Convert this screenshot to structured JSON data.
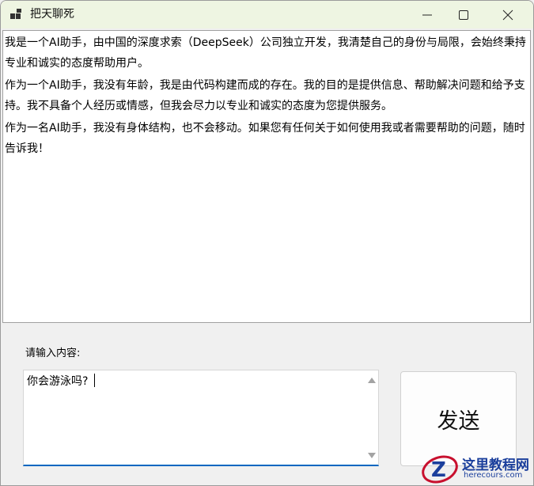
{
  "window": {
    "title": "把天聊死",
    "app_icon": "app-window-icon",
    "controls": {
      "minimize_icon": "minimize-icon",
      "maximize_icon": "maximize-icon",
      "close_icon": "close-icon"
    }
  },
  "chat": {
    "lines": [
      "我是一个AI助手，由中国的深度求索（DeepSeek）公司独立开发，我清楚自己的身份与局限，会始终秉持专业和诚实的态度帮助用户。",
      "作为一个AI助手，我没有年龄，我是由代码构建而成的存在。我的目的是提供信息、帮助解决问题和给予支持。我不具备个人经历或情感，但我会尽力以专业和诚实的态度为您提供服务。",
      "作为一名AI助手，我没有身体结构，也不会移动。如果您有任何关于如何使用我或者需要帮助的问题，随时告诉我！"
    ]
  },
  "input": {
    "label": "请输入内容:",
    "value": "你会游泳吗?"
  },
  "send_button": {
    "label": "发送"
  },
  "watermark": {
    "text": "这里教程网",
    "url": "herecours.com"
  },
  "colors": {
    "titlebar": "#eef5e2",
    "input_focus_border": "#0067c0",
    "watermark": "#1b3f9c"
  }
}
